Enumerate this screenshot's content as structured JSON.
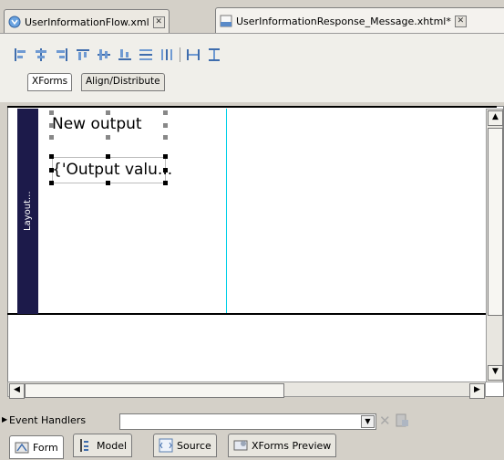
{
  "editor_tabs": [
    {
      "label": "UserInformationFlow.xml",
      "active": false
    },
    {
      "label": "UserInformationResponse_Message.xhtml*",
      "active": true
    }
  ],
  "toolbar": {
    "icons": [
      "align-left-icon",
      "align-center-icon",
      "align-right-icon",
      "align-top-icon",
      "align-middle-icon",
      "align-bottom-icon",
      "distribute-vertical-icon",
      "distribute-horizontal-icon",
      "same-width-icon",
      "same-height-icon"
    ]
  },
  "subtabs": [
    {
      "label": "XForms",
      "active": true
    },
    {
      "label": "Align/Distribute",
      "active": false
    }
  ],
  "canvas": {
    "layout_label": "Layout...",
    "output_label": "New output",
    "output_value": "{'Output valu..."
  },
  "event_handlers": {
    "label": "Event Handlers",
    "value": ""
  },
  "bottom_tabs": [
    {
      "label": "Form",
      "active": true
    },
    {
      "label": "Model",
      "active": false
    },
    {
      "label": "Source",
      "active": false
    },
    {
      "label": "XForms Preview",
      "active": false
    }
  ],
  "colors": {
    "layout_bar": "#1c1a4a",
    "guide_line": "#00d0e8",
    "accent_icon": "#3f6dad"
  }
}
